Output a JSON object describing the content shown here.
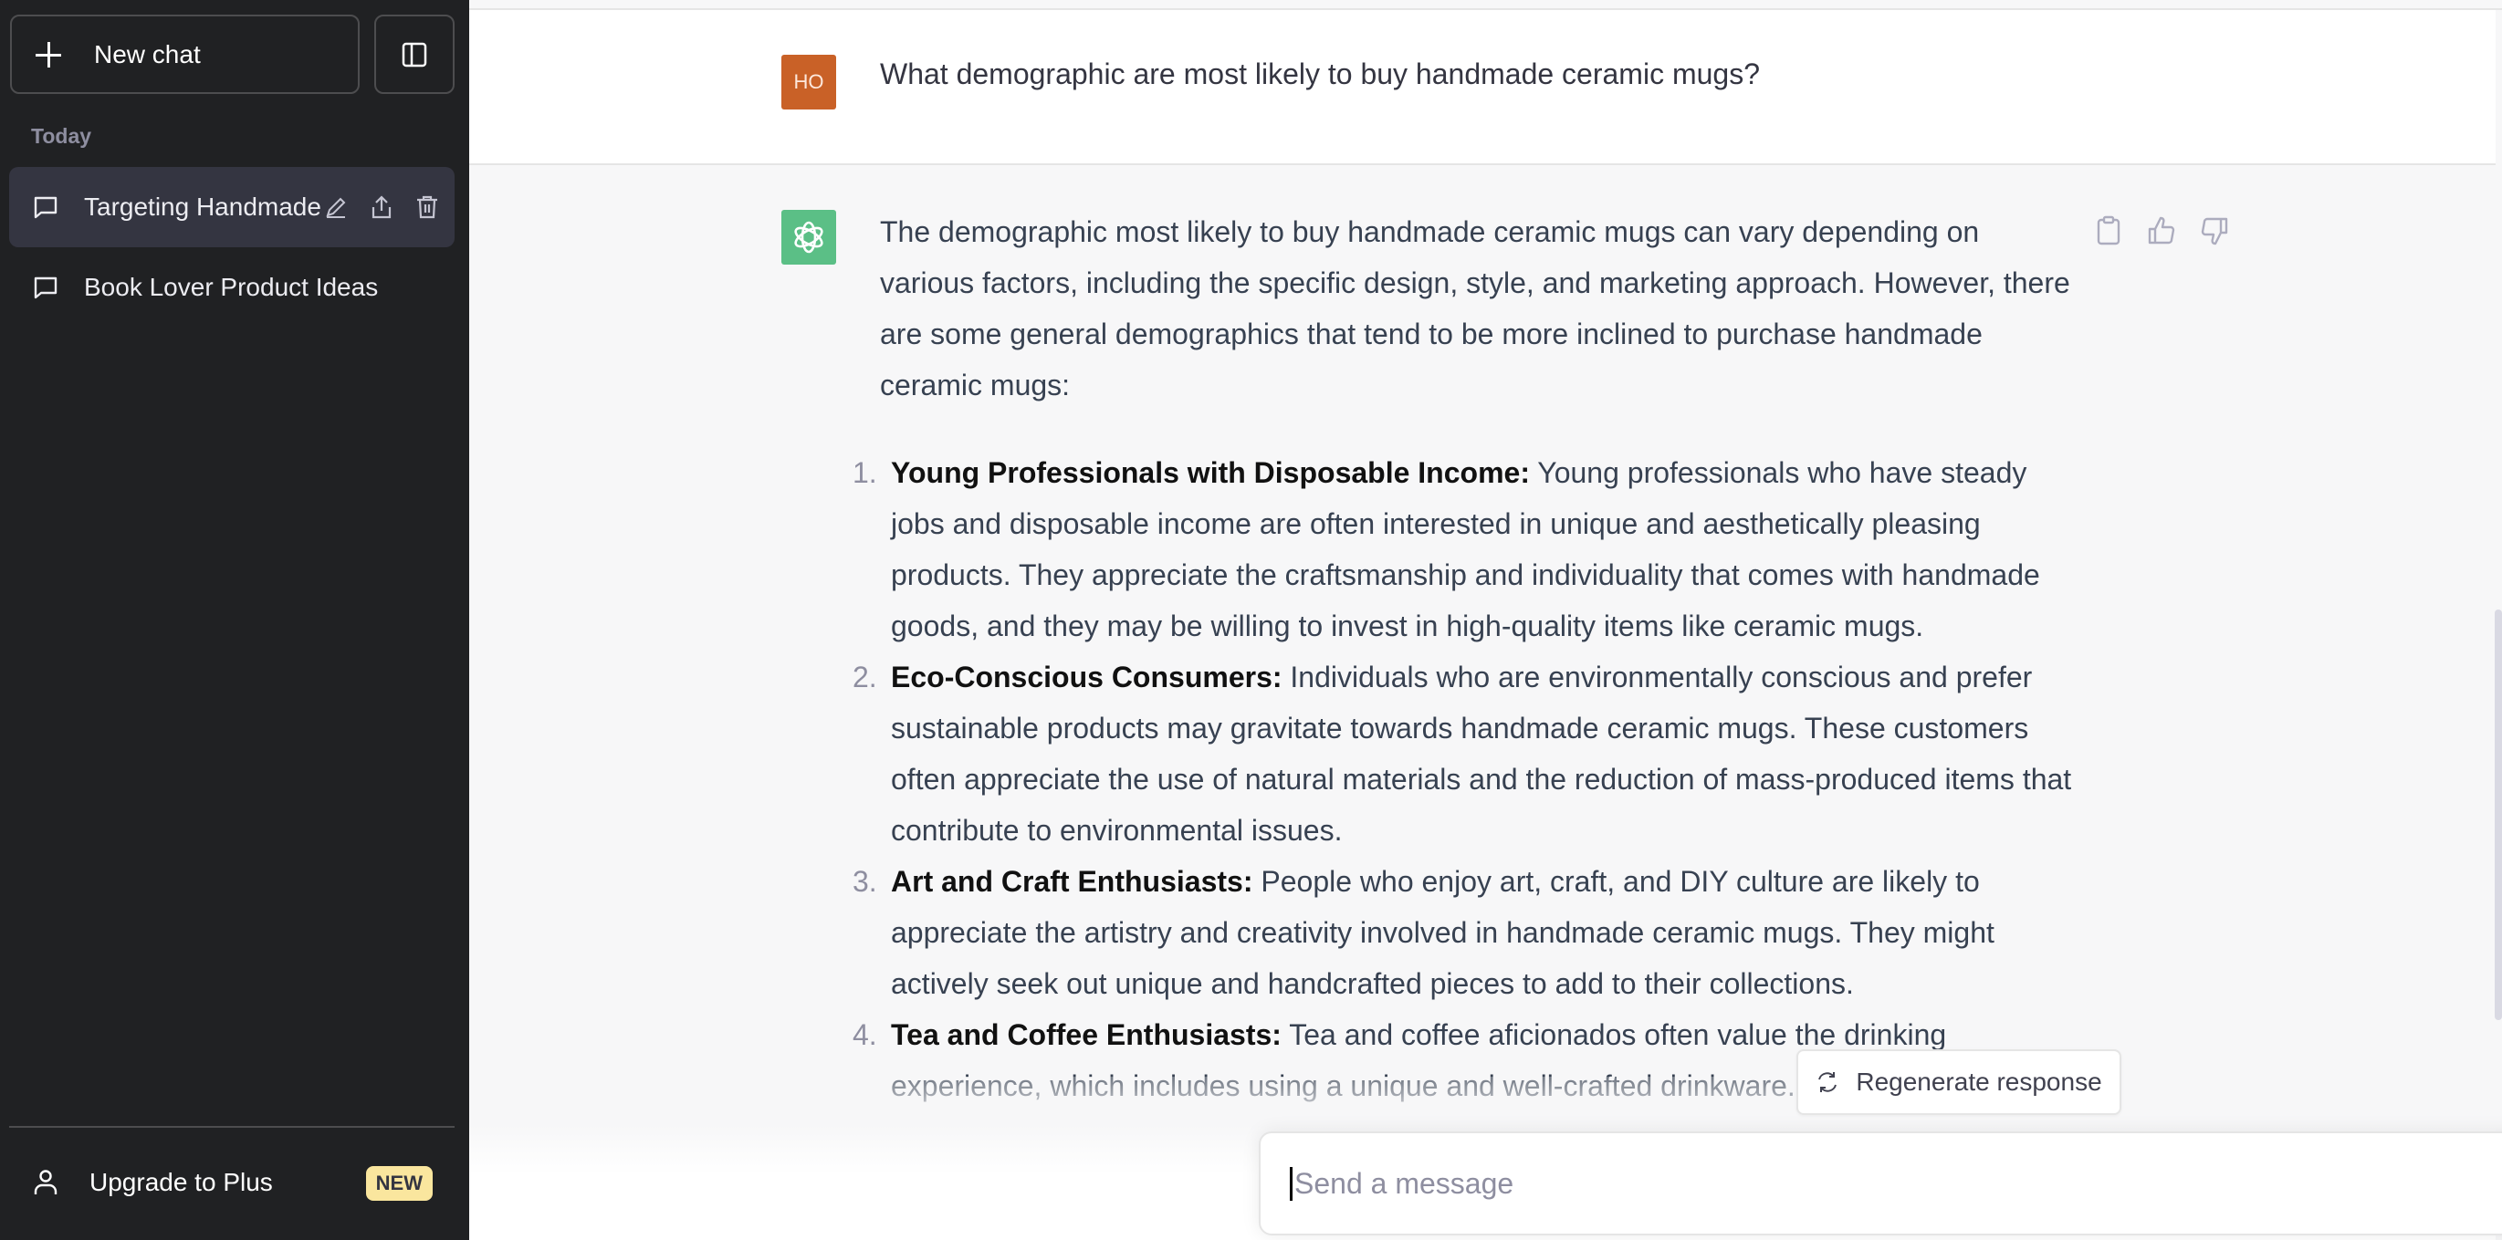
{
  "sidebar": {
    "new_chat_label": "New chat",
    "toggle_icon": "sidebar-toggle-icon",
    "section_label": "Today",
    "chats": [
      {
        "title": "Targeting Handmade",
        "active": true,
        "actions": [
          "edit-icon",
          "share-icon",
          "delete-icon"
        ]
      },
      {
        "title": "Book Lover Product Ideas",
        "active": false
      }
    ],
    "upgrade": {
      "label": "Upgrade to Plus",
      "badge": "NEW"
    }
  },
  "conversation": {
    "user": {
      "avatar_initials": "HO",
      "avatar_color": "#c96127",
      "message": "What demographic are most likely to buy handmade ceramic mugs?"
    },
    "assistant": {
      "avatar_color": "#5bbf86",
      "intro": "The demographic most likely to buy handmade ceramic mugs can vary depending on various factors, including the specific design, style, and marketing approach. However, there are some general demographics that tend to be more inclined to purchase handmade ceramic mugs:",
      "items": [
        {
          "num": "1.",
          "title": "Young Professionals with Disposable Income:",
          "text": " Young professionals who have steady jobs and disposable income are often interested in unique and aesthetically pleasing products. They appreciate the craftsmanship and individuality that comes with handmade goods, and they may be willing to invest in high-quality items like ceramic mugs."
        },
        {
          "num": "2.",
          "title": "Eco-Conscious Consumers:",
          "text": " Individuals who are environmentally conscious and prefer sustainable products may gravitate towards handmade ceramic mugs. These customers often appreciate the use of natural materials and the reduction of mass-produced items that contribute to environmental issues."
        },
        {
          "num": "3.",
          "title": "Art and Craft Enthusiasts:",
          "text": " People who enjoy art, craft, and DIY culture are likely to appreciate the artistry and creativity involved in handmade ceramic mugs. They might actively seek out unique and handcrafted pieces to add to their collections."
        },
        {
          "num": "4.",
          "title": "Tea and Coffee Enthusiasts:",
          "text": " Tea and coffee aficionados often value the drinking experience, which includes using a unique and well-crafted drinkware."
        }
      ],
      "actions": [
        "copy-icon",
        "thumbs-up-icon",
        "thumbs-down-icon"
      ]
    }
  },
  "composer": {
    "regenerate_label": "Regenerate response",
    "placeholder": "Send a message",
    "value": ""
  }
}
